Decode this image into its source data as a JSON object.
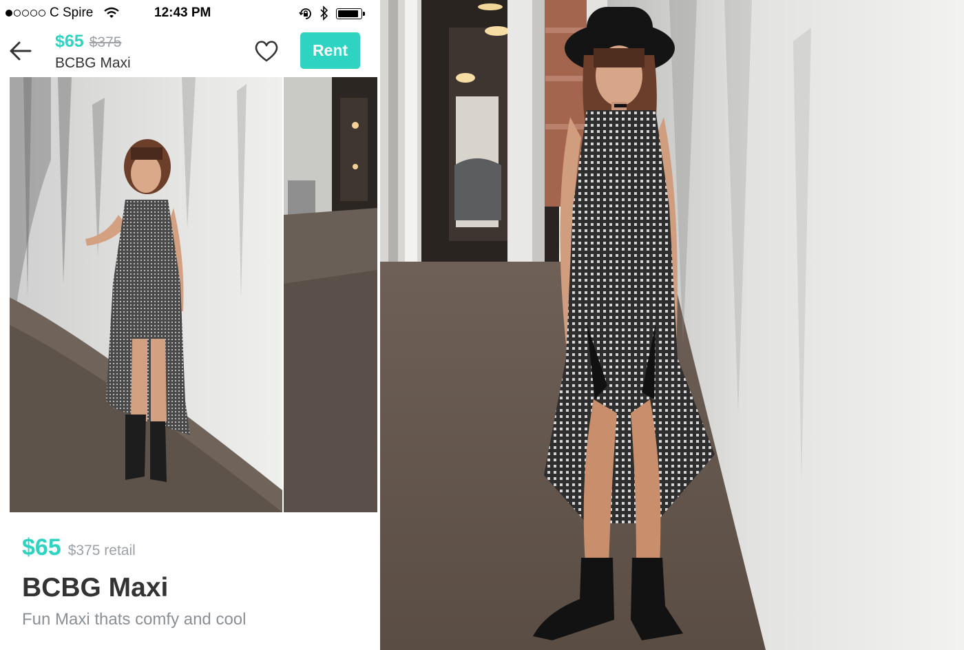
{
  "status_bar": {
    "carrier": "C Spire",
    "time": "12:43 PM",
    "signal_bars_filled": 1,
    "signal_bars_total": 5
  },
  "nav": {
    "price": "$65",
    "original_price": "$375",
    "title": "BCBG Maxi",
    "rent_label": "Rent"
  },
  "product": {
    "price": "$65",
    "retail": "$375 retail",
    "title": "BCBG Maxi",
    "description": "Fun Maxi thats comfy and cool"
  },
  "colors": {
    "accent": "#2fd3c1",
    "muted_text": "#9aa0a6",
    "body_text": "#333333"
  },
  "icons": [
    "signal-dots-icon",
    "wifi-icon",
    "rotation-lock-icon",
    "bluetooth-icon",
    "battery-icon",
    "back-arrow-icon",
    "heart-icon"
  ]
}
